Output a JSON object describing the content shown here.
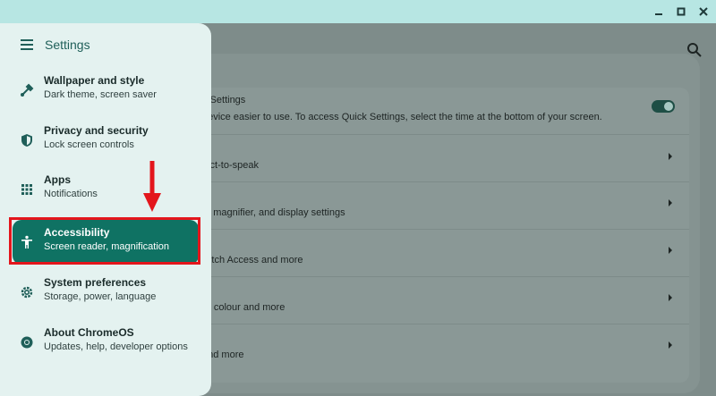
{
  "window": {
    "buttons": [
      "minimize",
      "maximize",
      "close"
    ]
  },
  "drawer": {
    "title": "Settings",
    "items": [
      {
        "label": "Wallpaper and style",
        "sub": "Dark theme, screen saver",
        "icon": "paint-brush-icon"
      },
      {
        "label": "Privacy and security",
        "sub": "Lock screen controls",
        "icon": "shield-icon"
      },
      {
        "label": "Apps",
        "sub": "Notifications",
        "icon": "apps-grid-icon"
      },
      {
        "label": "Accessibility",
        "sub": "Screen reader, magnification",
        "icon": "accessibility-icon",
        "active": true
      },
      {
        "label": "System preferences",
        "sub": "Storage, power, language",
        "icon": "gear-icon"
      },
      {
        "label": "About ChromeOS",
        "sub": "Updates, help, developer options",
        "icon": "chrome-icon"
      }
    ]
  },
  "content": {
    "rows": [
      {
        "title": "k Settings",
        "sub": "device easier to use. To access Quick Settings, select the time at the bottom of your screen.",
        "toggle": true
      },
      {
        "text": "lect-to-speak"
      },
      {
        "text": "n, magnifier, and display settings"
      },
      {
        "text": "witch Access and more"
      },
      {
        "text": "or colour and more"
      },
      {
        "text": "and more"
      }
    ]
  },
  "annotation": {
    "color": "#e3161c"
  },
  "colors": {
    "accent": "#0f7263",
    "titlebar": "#b7e6e3",
    "drawer": "#e4f2f0"
  }
}
